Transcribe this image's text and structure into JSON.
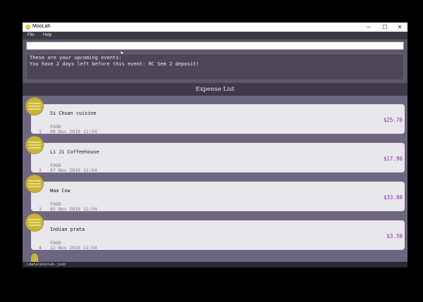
{
  "window": {
    "title": "MooLah",
    "minimize": "─",
    "maximize": "☐",
    "close": "✕"
  },
  "menu": {
    "file": "File",
    "help": "Help"
  },
  "command": {
    "value": ""
  },
  "result": {
    "line1": "These are your upcoming events:",
    "line2": "You have 2 days left before this event: RC Sem 2 deposit!"
  },
  "expense_list": {
    "header": "Expense List",
    "items": [
      {
        "index": "1",
        "description": "Si Chuan cuisine",
        "category": "FOOD",
        "date": "09 Nov 2019 11:54",
        "price": "$25.70"
      },
      {
        "index": "2",
        "description": "Li Ji Coffeehouse",
        "category": "FOOD",
        "date": "07 Nov 2019 11:54",
        "price": "$17.90"
      },
      {
        "index": "3",
        "description": "Waa Cow",
        "category": "FOOD",
        "date": "02 Nov 2019 11:54",
        "price": "$33.80"
      },
      {
        "index": "4",
        "description": "Indian prata",
        "category": "FOOD",
        "date": "12 Nov 2019 11:54",
        "price": "$3.50"
      }
    ]
  },
  "status": {
    "path": ".\\data\\moolah.json"
  },
  "colors": {
    "price": "#8a2ba6",
    "coin": "#c8b43c",
    "background": "#6e6680"
  }
}
